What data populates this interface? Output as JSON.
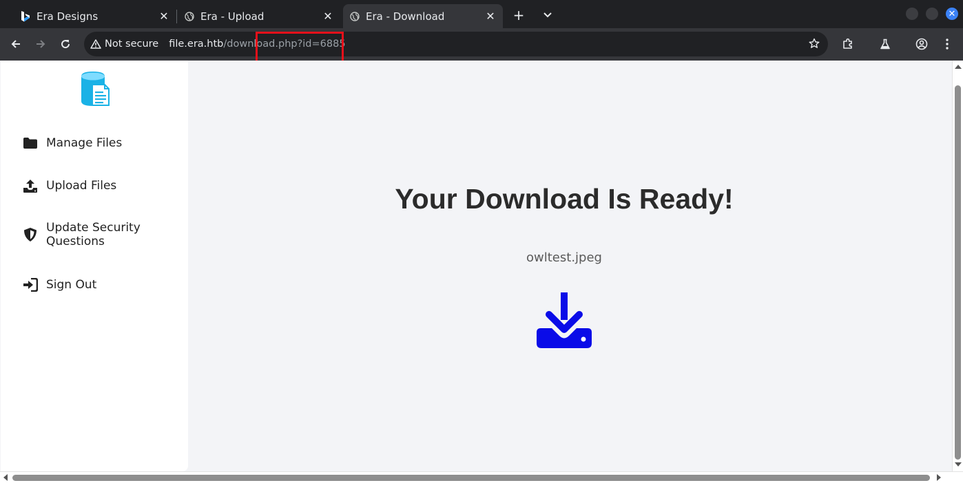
{
  "browser": {
    "tabs": [
      {
        "title": "Era Designs",
        "icon": "bing-icon",
        "active": false
      },
      {
        "title": "Era - Upload",
        "icon": "globe-icon",
        "active": false
      },
      {
        "title": "Era - Download",
        "icon": "globe-icon",
        "active": true
      }
    ],
    "security_label": "Not secure",
    "url_host": "file.era.htb",
    "url_path": "/download.php?id=6885",
    "highlight_color": "#e8101a",
    "accent_color": "#3b82f6"
  },
  "sidebar": {
    "items": [
      {
        "label": "Manage Files",
        "icon": "folder-icon"
      },
      {
        "label": "Upload Files",
        "icon": "upload-icon"
      },
      {
        "label": "Update Security Questions",
        "icon": "shield-icon"
      },
      {
        "label": "Sign Out",
        "icon": "sign-out-icon"
      }
    ],
    "logo_color": "#1ab2e6"
  },
  "main": {
    "headline": "Your Download Is Ready!",
    "filename": "owltest.jpeg",
    "download_icon": "download-icon",
    "download_icon_color": "#0a0ce8"
  }
}
